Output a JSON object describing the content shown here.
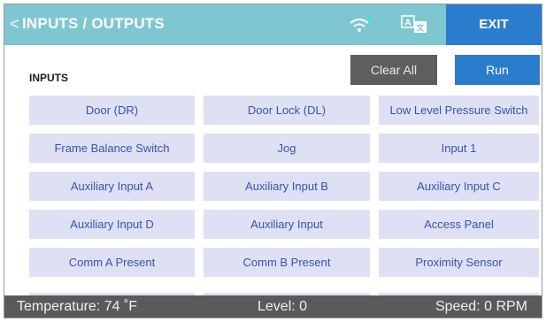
{
  "header": {
    "back_glyph": "<",
    "title": "INPUTS / OUTPUTS",
    "wifi_icon": "wifi-icon",
    "language_icon": "language-icon",
    "exit_label": "EXIT",
    "bg_color": "#7fc7d0",
    "exit_color": "#2a7dcd"
  },
  "toolbar": {
    "section_label": "INPUTS",
    "clear_all_label": "Clear All",
    "run_label": "Run"
  },
  "inputs": [
    [
      "Door (DR)",
      "Door Lock (DL)",
      "Low Level Pressure Switch"
    ],
    [
      "Frame Balance Switch",
      "Jog",
      "Input 1"
    ],
    [
      "Auxiliary Input A",
      "Auxiliary Input B",
      "Auxiliary Input C"
    ],
    [
      "Auxiliary Input D",
      "Auxiliary Input",
      "Access Panel"
    ],
    [
      "Comm A Present",
      "Comm B Present",
      "Proximity Sensor"
    ]
  ],
  "status": {
    "temperature": "Temperature: 74 ˚F",
    "level": "Level: 0",
    "speed": "Speed: 0 RPM"
  }
}
